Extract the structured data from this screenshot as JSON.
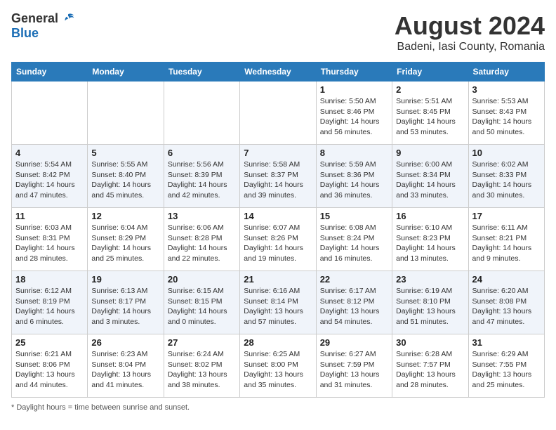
{
  "header": {
    "logo_general": "General",
    "logo_blue": "Blue",
    "month_year": "August 2024",
    "location": "Badeni, Iasi County, Romania"
  },
  "days_of_week": [
    "Sunday",
    "Monday",
    "Tuesday",
    "Wednesday",
    "Thursday",
    "Friday",
    "Saturday"
  ],
  "weeks": [
    [
      {
        "num": "",
        "info": ""
      },
      {
        "num": "",
        "info": ""
      },
      {
        "num": "",
        "info": ""
      },
      {
        "num": "",
        "info": ""
      },
      {
        "num": "1",
        "info": "Sunrise: 5:50 AM\nSunset: 8:46 PM\nDaylight: 14 hours and 56 minutes."
      },
      {
        "num": "2",
        "info": "Sunrise: 5:51 AM\nSunset: 8:45 PM\nDaylight: 14 hours and 53 minutes."
      },
      {
        "num": "3",
        "info": "Sunrise: 5:53 AM\nSunset: 8:43 PM\nDaylight: 14 hours and 50 minutes."
      }
    ],
    [
      {
        "num": "4",
        "info": "Sunrise: 5:54 AM\nSunset: 8:42 PM\nDaylight: 14 hours and 47 minutes."
      },
      {
        "num": "5",
        "info": "Sunrise: 5:55 AM\nSunset: 8:40 PM\nDaylight: 14 hours and 45 minutes."
      },
      {
        "num": "6",
        "info": "Sunrise: 5:56 AM\nSunset: 8:39 PM\nDaylight: 14 hours and 42 minutes."
      },
      {
        "num": "7",
        "info": "Sunrise: 5:58 AM\nSunset: 8:37 PM\nDaylight: 14 hours and 39 minutes."
      },
      {
        "num": "8",
        "info": "Sunrise: 5:59 AM\nSunset: 8:36 PM\nDaylight: 14 hours and 36 minutes."
      },
      {
        "num": "9",
        "info": "Sunrise: 6:00 AM\nSunset: 8:34 PM\nDaylight: 14 hours and 33 minutes."
      },
      {
        "num": "10",
        "info": "Sunrise: 6:02 AM\nSunset: 8:33 PM\nDaylight: 14 hours and 30 minutes."
      }
    ],
    [
      {
        "num": "11",
        "info": "Sunrise: 6:03 AM\nSunset: 8:31 PM\nDaylight: 14 hours and 28 minutes."
      },
      {
        "num": "12",
        "info": "Sunrise: 6:04 AM\nSunset: 8:29 PM\nDaylight: 14 hours and 25 minutes."
      },
      {
        "num": "13",
        "info": "Sunrise: 6:06 AM\nSunset: 8:28 PM\nDaylight: 14 hours and 22 minutes."
      },
      {
        "num": "14",
        "info": "Sunrise: 6:07 AM\nSunset: 8:26 PM\nDaylight: 14 hours and 19 minutes."
      },
      {
        "num": "15",
        "info": "Sunrise: 6:08 AM\nSunset: 8:24 PM\nDaylight: 14 hours and 16 minutes."
      },
      {
        "num": "16",
        "info": "Sunrise: 6:10 AM\nSunset: 8:23 PM\nDaylight: 14 hours and 13 minutes."
      },
      {
        "num": "17",
        "info": "Sunrise: 6:11 AM\nSunset: 8:21 PM\nDaylight: 14 hours and 9 minutes."
      }
    ],
    [
      {
        "num": "18",
        "info": "Sunrise: 6:12 AM\nSunset: 8:19 PM\nDaylight: 14 hours and 6 minutes."
      },
      {
        "num": "19",
        "info": "Sunrise: 6:13 AM\nSunset: 8:17 PM\nDaylight: 14 hours and 3 minutes."
      },
      {
        "num": "20",
        "info": "Sunrise: 6:15 AM\nSunset: 8:15 PM\nDaylight: 14 hours and 0 minutes."
      },
      {
        "num": "21",
        "info": "Sunrise: 6:16 AM\nSunset: 8:14 PM\nDaylight: 13 hours and 57 minutes."
      },
      {
        "num": "22",
        "info": "Sunrise: 6:17 AM\nSunset: 8:12 PM\nDaylight: 13 hours and 54 minutes."
      },
      {
        "num": "23",
        "info": "Sunrise: 6:19 AM\nSunset: 8:10 PM\nDaylight: 13 hours and 51 minutes."
      },
      {
        "num": "24",
        "info": "Sunrise: 6:20 AM\nSunset: 8:08 PM\nDaylight: 13 hours and 47 minutes."
      }
    ],
    [
      {
        "num": "25",
        "info": "Sunrise: 6:21 AM\nSunset: 8:06 PM\nDaylight: 13 hours and 44 minutes."
      },
      {
        "num": "26",
        "info": "Sunrise: 6:23 AM\nSunset: 8:04 PM\nDaylight: 13 hours and 41 minutes."
      },
      {
        "num": "27",
        "info": "Sunrise: 6:24 AM\nSunset: 8:02 PM\nDaylight: 13 hours and 38 minutes."
      },
      {
        "num": "28",
        "info": "Sunrise: 6:25 AM\nSunset: 8:00 PM\nDaylight: 13 hours and 35 minutes."
      },
      {
        "num": "29",
        "info": "Sunrise: 6:27 AM\nSunset: 7:59 PM\nDaylight: 13 hours and 31 minutes."
      },
      {
        "num": "30",
        "info": "Sunrise: 6:28 AM\nSunset: 7:57 PM\nDaylight: 13 hours and 28 minutes."
      },
      {
        "num": "31",
        "info": "Sunrise: 6:29 AM\nSunset: 7:55 PM\nDaylight: 13 hours and 25 minutes."
      }
    ]
  ],
  "footer": {
    "note": "Daylight hours"
  }
}
